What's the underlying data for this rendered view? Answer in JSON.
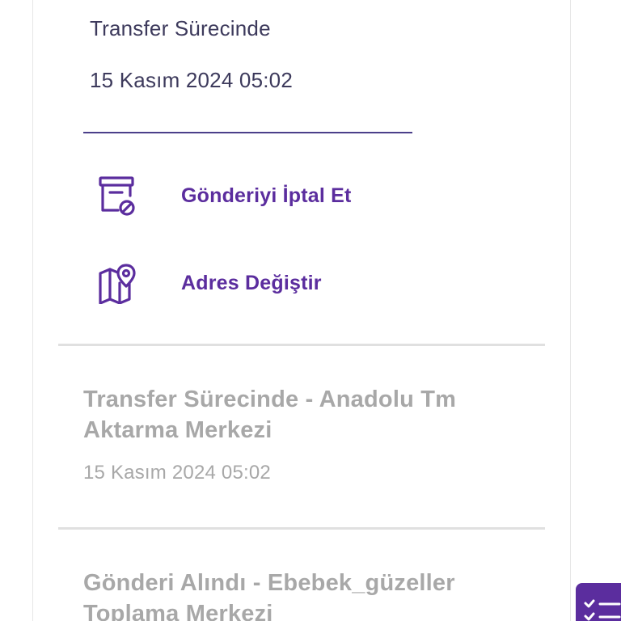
{
  "current_status": {
    "title": "Transfer Sürecinde",
    "date": "15 Kasım 2024 05:02"
  },
  "actions": [
    {
      "label": "Gönderiyi İptal Et",
      "icon": "cancel-shipment-icon"
    },
    {
      "label": "Adres Değiştir",
      "icon": "map-pin-icon"
    }
  ],
  "history": [
    {
      "title": "Transfer Sürecinde - Anadolu Tm Aktarma Merkezi",
      "date": "15 Kasım 2024 05:02"
    },
    {
      "title": "Gönderi Alındı - Ebebek_güzeller Toplama Merkezi"
    }
  ],
  "fab": {
    "icon": "checklist-icon"
  },
  "colors": {
    "accent": "#5b2d9e",
    "text_primary": "#3d3a5c",
    "text_muted": "#a8a8a8",
    "divider": "#e0e0e0"
  }
}
